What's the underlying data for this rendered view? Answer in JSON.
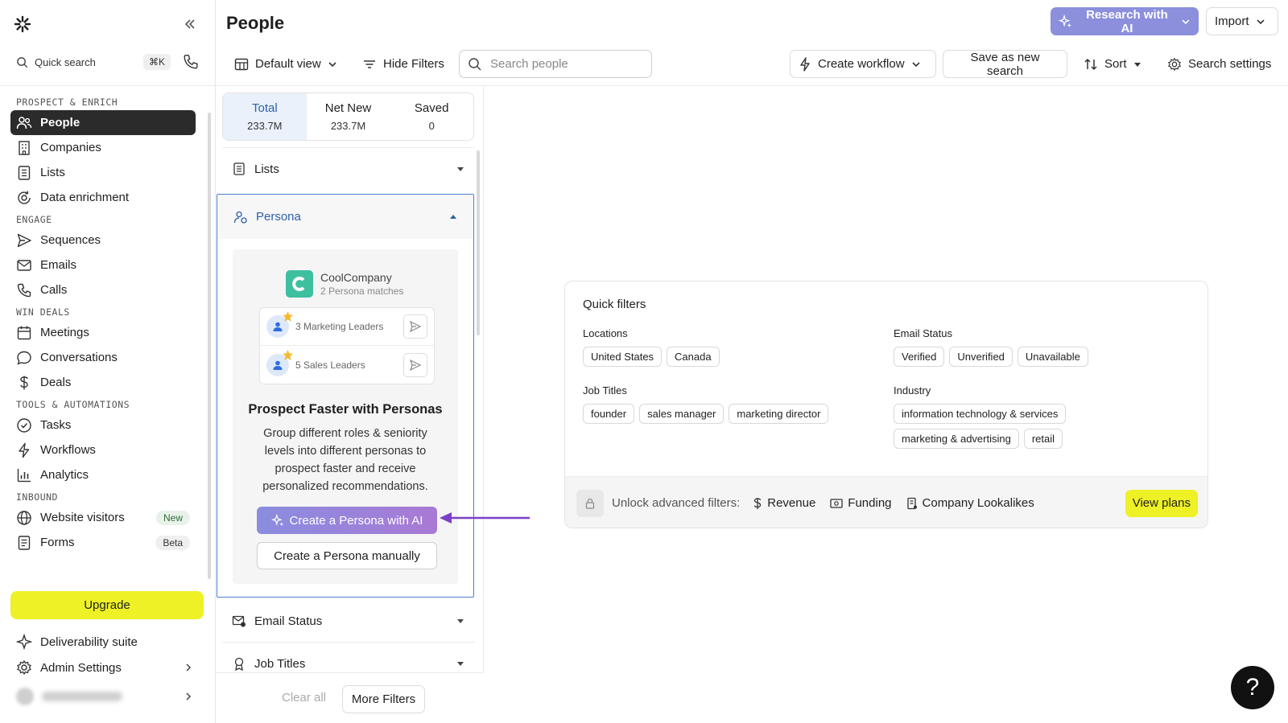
{
  "sidebar": {
    "quick_search": "Quick search",
    "shortcut": "⌘K",
    "sections": [
      {
        "label": "PROSPECT & ENRICH",
        "items": [
          {
            "label": "People",
            "icon": "people-icon",
            "active": true
          },
          {
            "label": "Companies",
            "icon": "building-icon"
          },
          {
            "label": "Lists",
            "icon": "list-icon"
          },
          {
            "label": "Data enrichment",
            "icon": "enrich-icon"
          }
        ]
      },
      {
        "label": "ENGAGE",
        "items": [
          {
            "label": "Sequences",
            "icon": "send-icon"
          },
          {
            "label": "Emails",
            "icon": "mail-icon"
          },
          {
            "label": "Calls",
            "icon": "phone-icon"
          }
        ]
      },
      {
        "label": "WIN DEALS",
        "items": [
          {
            "label": "Meetings",
            "icon": "calendar-icon"
          },
          {
            "label": "Conversations",
            "icon": "chat-icon"
          },
          {
            "label": "Deals",
            "icon": "dollar-icon"
          }
        ]
      },
      {
        "label": "TOOLS & AUTOMATIONS",
        "items": [
          {
            "label": "Tasks",
            "icon": "check-circle-icon"
          },
          {
            "label": "Workflows",
            "icon": "bolt-icon"
          },
          {
            "label": "Analytics",
            "icon": "chart-icon"
          }
        ]
      },
      {
        "label": "INBOUND",
        "items": [
          {
            "label": "Website visitors",
            "icon": "globe-icon",
            "badge": "New"
          },
          {
            "label": "Forms",
            "icon": "form-icon",
            "badge": "Beta"
          }
        ]
      }
    ],
    "upgrade": "Upgrade",
    "deliverability": "Deliverability suite",
    "admin": "Admin Settings"
  },
  "header": {
    "title": "People",
    "research": "Research with AI",
    "import": "Import",
    "default_view": "Default view",
    "hide_filters": "Hide Filters",
    "search_placeholder": "Search people",
    "create_workflow": "Create workflow",
    "save_search": "Save as new search",
    "sort": "Sort",
    "search_settings": "Search settings"
  },
  "filters": {
    "tabs": [
      {
        "label": "Total",
        "value": "233.7M"
      },
      {
        "label": "Net New",
        "value": "233.7M"
      },
      {
        "label": "Saved",
        "value": "0"
      }
    ],
    "lists": "Lists",
    "persona": {
      "label": "Persona",
      "company": "CoolCompany",
      "matches": "2 Persona matches",
      "rows": [
        "3 Marketing Leaders",
        "5 Sales Leaders"
      ],
      "title": "Prospect Faster with Personas",
      "description": "Group different roles & seniority levels into different personas to prospect faster and receive personalized recommendations.",
      "ai_button": "Create a Persona with AI",
      "manual_button": "Create a Persona manually"
    },
    "email_status": "Email Status",
    "job_titles": "Job Titles",
    "clear_all": "Clear all",
    "more_filters": "More Filters"
  },
  "quick_filters": {
    "title": "Quick filters",
    "locations": {
      "label": "Locations",
      "chips": [
        "United States",
        "Canada"
      ]
    },
    "email_status": {
      "label": "Email Status",
      "chips": [
        "Verified",
        "Unverified",
        "Unavailable"
      ]
    },
    "job_titles": {
      "label": "Job Titles",
      "chips": [
        "founder",
        "sales manager",
        "marketing director"
      ]
    },
    "industry": {
      "label": "Industry",
      "chips": [
        "information technology & services",
        "marketing & advertising",
        "retail"
      ]
    },
    "unlock": "Unlock advanced filters:",
    "features": [
      {
        "label": "Revenue",
        "icon": "dollar-icon"
      },
      {
        "label": "Funding",
        "icon": "funding-icon"
      },
      {
        "label": "Company Lookalikes",
        "icon": "lookalike-icon"
      }
    ],
    "view_plans": "View plans"
  },
  "help": "?",
  "colors": {
    "accent": "#2d5fa8",
    "upgrade": "#eef125",
    "ai_gradient_start": "#8a8de0",
    "ai_gradient_end": "#a979d4",
    "arrow": "#7b3fc9"
  }
}
